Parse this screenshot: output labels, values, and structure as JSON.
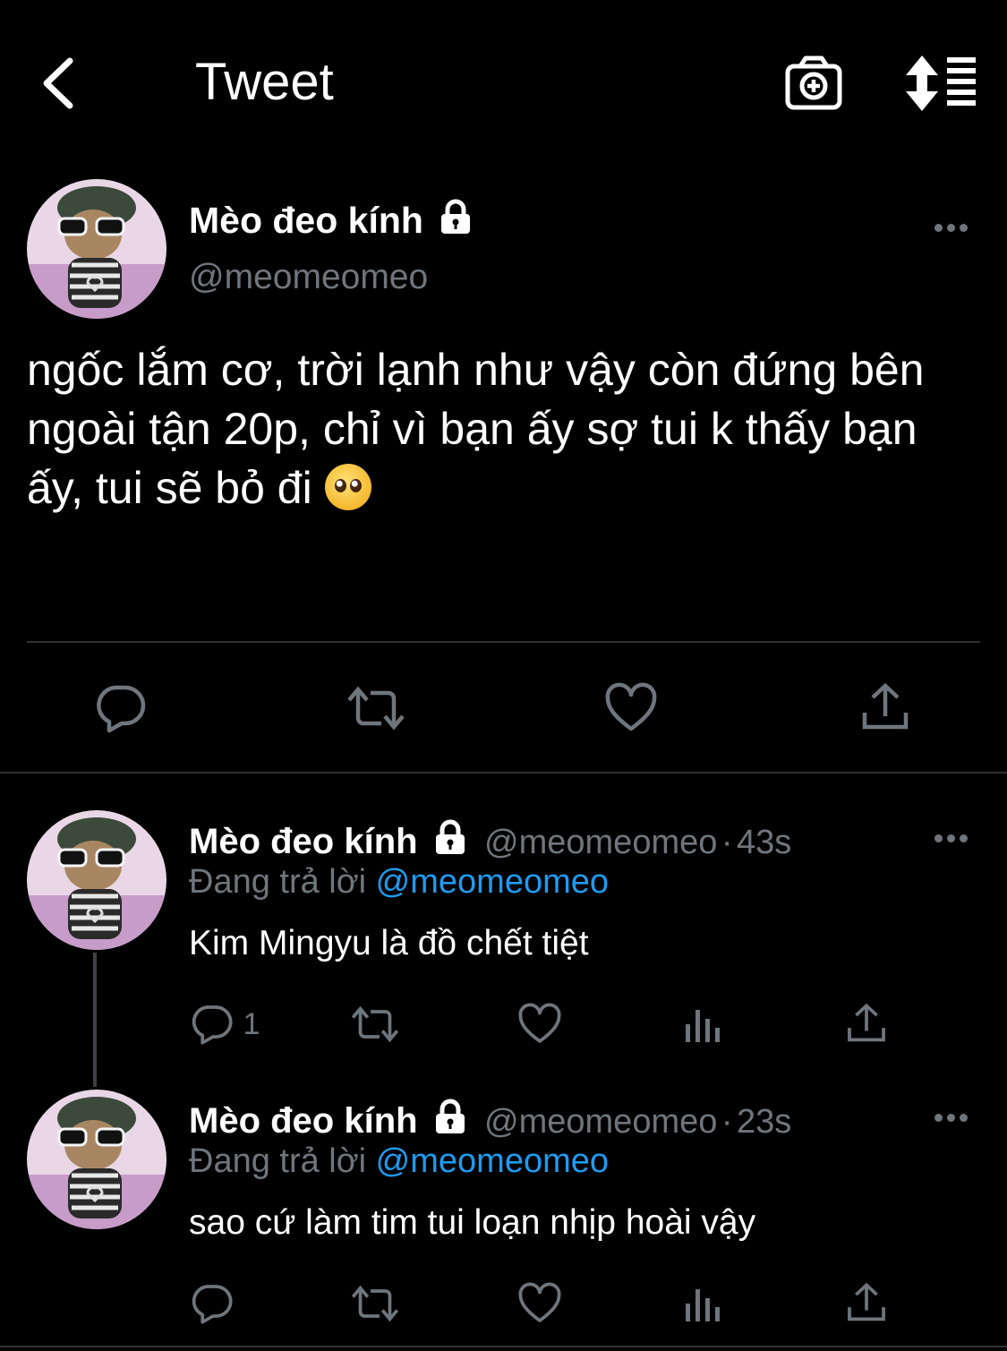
{
  "header": {
    "title": "Tweet",
    "back_icon": "chevron-left-icon",
    "camera_icon": "camera-add-icon",
    "sort_icon": "sort-icon"
  },
  "main_tweet": {
    "author_name": "Mèo đeo kính",
    "handle": "@meomeomeo",
    "text": "ngốc lắm cơ, trời lạnh như vậy còn đứng bên ngoài tận 20p, chỉ vì bạn ấy sợ tui k thấy bạn ấy, tui sẽ bỏ đi",
    "emoji_icon": "pleading-face-icon",
    "actions": [
      "reply-icon",
      "retweet-icon",
      "like-icon",
      "share-icon"
    ]
  },
  "replies": [
    {
      "author_name": "Mèo đeo kính",
      "handle": "@meomeomeo",
      "separator": "·",
      "time": "43s",
      "replying_label": "Đang trả lời",
      "replying_to": "@meomeomeo",
      "text": "Kim Mingyu là đồ chết tiệt",
      "reply_count": "1"
    },
    {
      "author_name": "Mèo đeo kính",
      "handle": "@meomeomeo",
      "separator": "·",
      "time": "23s",
      "replying_label": "Đang trả lời",
      "replying_to": "@meomeomeo",
      "text": "sao cứ làm tim tui loạn nhịp hoài vậy",
      "reply_count": ""
    }
  ],
  "colors": {
    "background": "#000000",
    "muted": "#6e767d",
    "accent": "#1d9bf0",
    "divider": "#2f3336"
  }
}
